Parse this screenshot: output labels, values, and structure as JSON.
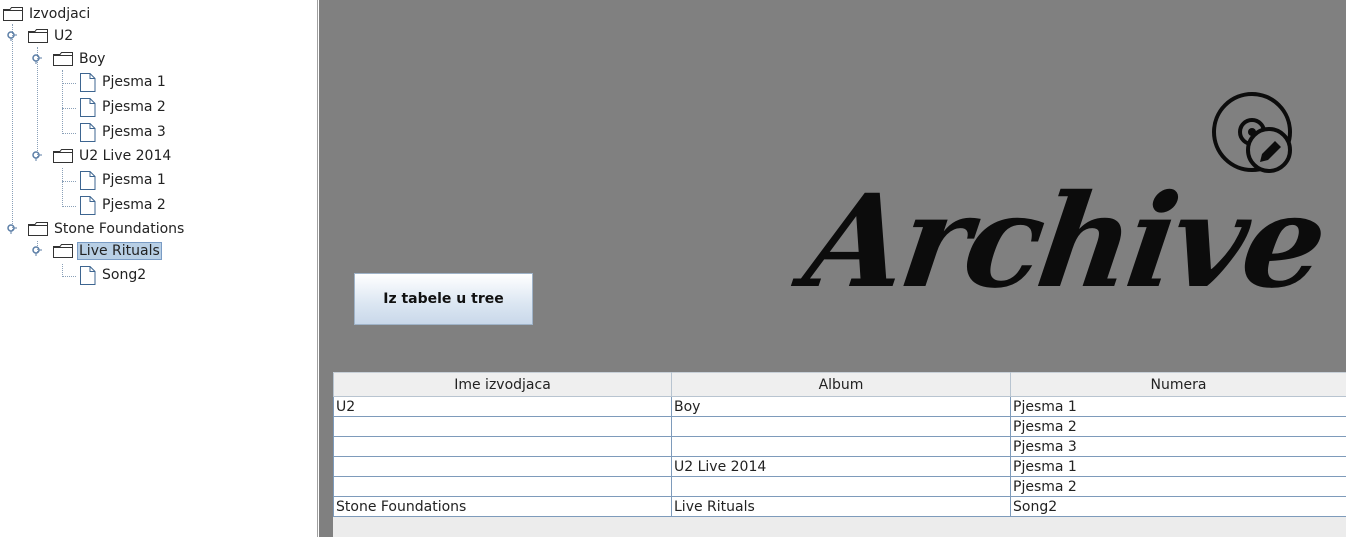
{
  "tree": {
    "root": {
      "label": "Izvodjaci",
      "icon": "folder-icon"
    },
    "nodes": [
      {
        "label": "U2",
        "icon": "folder-icon"
      },
      {
        "label": "Boy",
        "icon": "folder-icon"
      },
      {
        "label": "Pjesma 1",
        "icon": "file-icon"
      },
      {
        "label": "Pjesma 2",
        "icon": "file-icon"
      },
      {
        "label": "Pjesma 3",
        "icon": "file-icon"
      },
      {
        "label": "U2 Live 2014",
        "icon": "folder-icon"
      },
      {
        "label": "Pjesma 1",
        "icon": "file-icon"
      },
      {
        "label": "Pjesma 2",
        "icon": "file-icon"
      },
      {
        "label": "Stone Foundations",
        "icon": "folder-icon"
      },
      {
        "label": "Live Rituals",
        "icon": "folder-icon",
        "selected": true
      },
      {
        "label": "Song2",
        "icon": "file-icon"
      }
    ]
  },
  "logo": {
    "text": "Archive",
    "icon": "disc-edit-icon"
  },
  "toolbar": {
    "transfer_label": "Iz tabele u tree"
  },
  "table": {
    "headers": [
      "Ime izvodjaca",
      "Album",
      "Numera"
    ],
    "rows": [
      [
        "U2",
        "Boy",
        "Pjesma 1"
      ],
      [
        "",
        "",
        "Pjesma 2"
      ],
      [
        "",
        "",
        "Pjesma 3"
      ],
      [
        "",
        "U2 Live 2014",
        "Pjesma 1"
      ],
      [
        "",
        "",
        "Pjesma 2"
      ],
      [
        "Stone Foundations",
        "Live Rituals",
        "Song2"
      ]
    ]
  },
  "colors": {
    "panel_bg": "#808080",
    "selection": "#b8cfe5",
    "grid": "#7e9bbb"
  }
}
